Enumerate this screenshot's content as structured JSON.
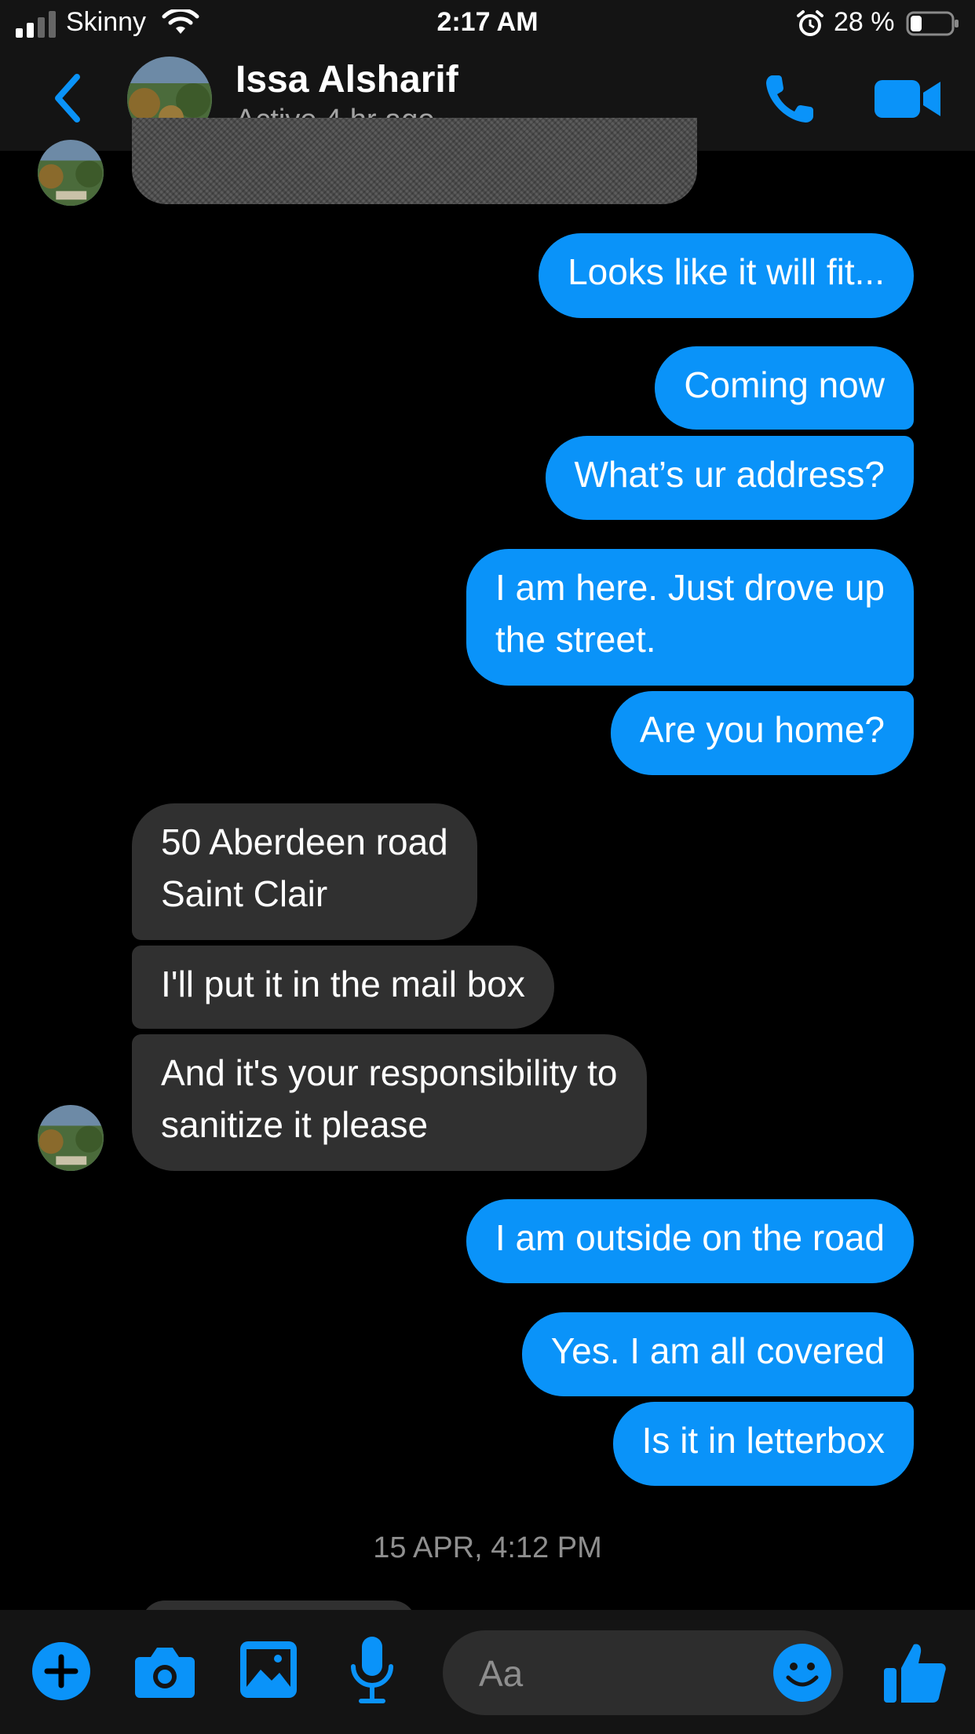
{
  "status_bar": {
    "carrier": "Skinny",
    "time": "2:17 AM",
    "battery": "28 %",
    "battery_level": 0.28
  },
  "header": {
    "contact_name": "Issa Alsharif",
    "presence": "Active 4 hr ago"
  },
  "messages": [
    {
      "side": "out",
      "text": "Looks like it will fit..."
    },
    {
      "side": "out",
      "text": "Coming now"
    },
    {
      "side": "out",
      "text": "What’s ur address?"
    },
    {
      "side": "out",
      "lines": [
        "I am here. Just drove up",
        "the street."
      ]
    },
    {
      "side": "out",
      "text": "Are you home?"
    },
    {
      "side": "in",
      "lines": [
        "50 Aberdeen road",
        "Saint Clair"
      ]
    },
    {
      "side": "in",
      "text": "I'll put it in the mail box"
    },
    {
      "side": "in",
      "lines": [
        "And it's your responsibility to",
        "sanitize it please"
      ]
    },
    {
      "side": "out",
      "text": "I am outside on the road"
    },
    {
      "side": "out",
      "text": "Yes. I am all covered"
    },
    {
      "side": "out",
      "text": "Is it in letterbox"
    }
  ],
  "timestamp": "15 APR, 4:12 PM",
  "composer": {
    "placeholder": "Aa"
  },
  "colors": {
    "accent": "#0a93f9",
    "incoming_bubble": "#303030",
    "background": "#000000",
    "bar": "#141414"
  },
  "icons": [
    "back-chevron-icon",
    "phone-icon",
    "video-camera-icon",
    "plus-icon",
    "camera-icon",
    "image-icon",
    "microphone-icon",
    "emoji-icon",
    "thumbs-up-icon"
  ]
}
